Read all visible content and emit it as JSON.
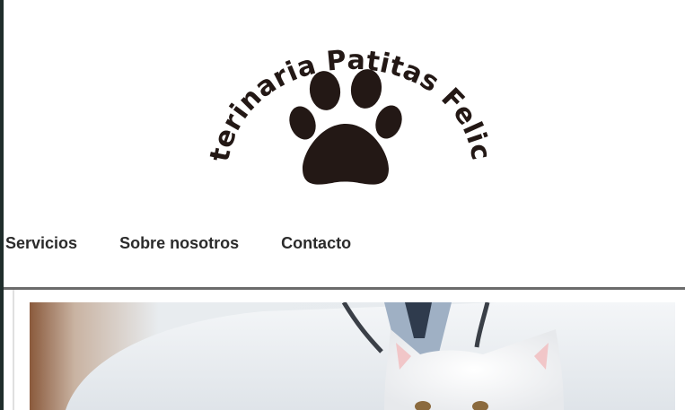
{
  "logo": {
    "text": "Veterinaria Patitas Felices",
    "icon": "paw-icon"
  },
  "nav": {
    "items": [
      {
        "label": "Servicios"
      },
      {
        "label": "Sobre nosotros"
      },
      {
        "label": "Contacto"
      }
    ]
  },
  "hero": {
    "image": "veterinarian-holding-white-kitten"
  },
  "colors": {
    "nav_text": "#2b2b2b",
    "logo_ink": "#231815",
    "divider": "#6b6b6b",
    "left_edge": "#1f2d2b"
  }
}
